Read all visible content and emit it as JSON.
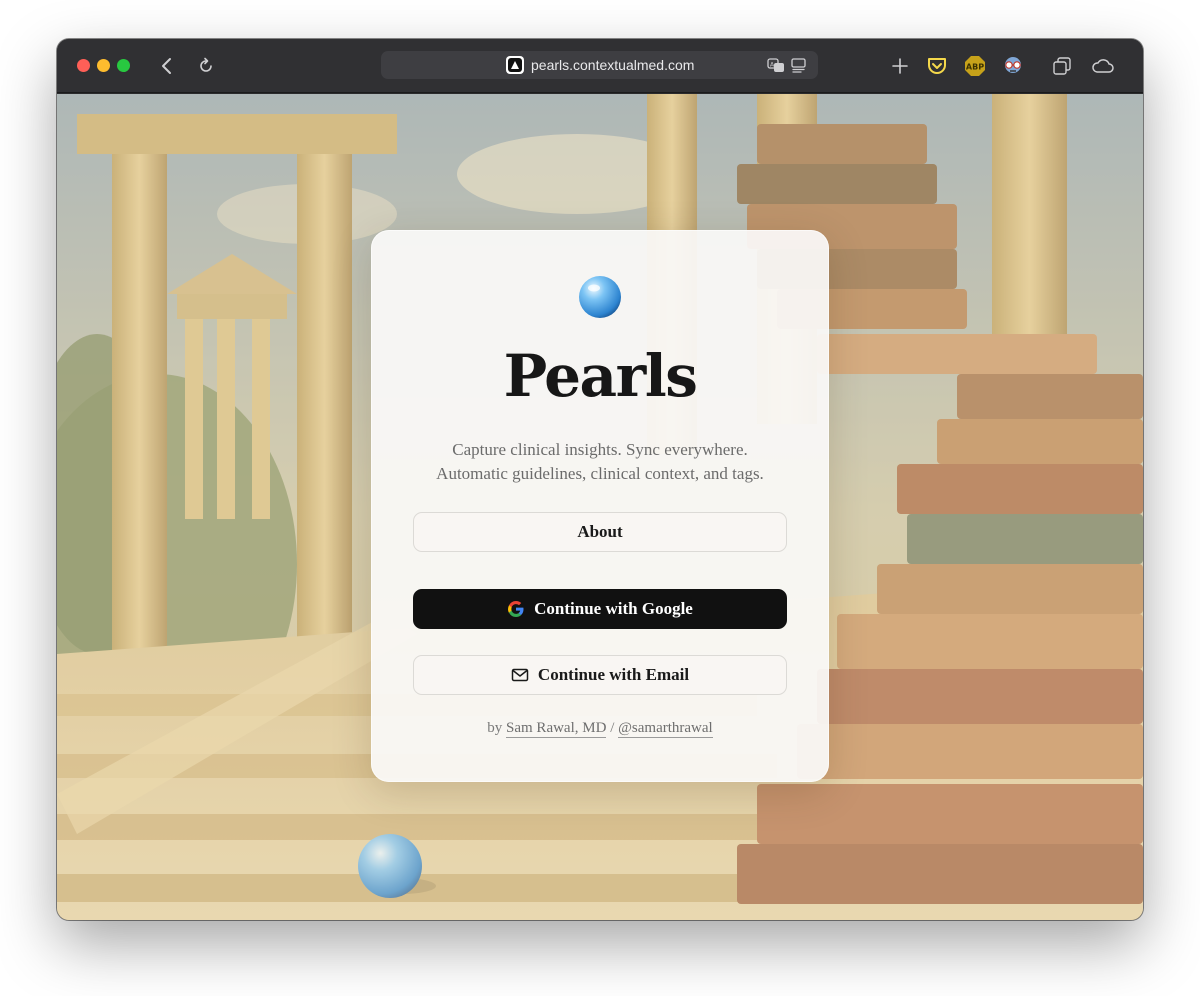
{
  "browser": {
    "url": "pearls.contextualmed.com",
    "icons": {
      "back": "chevron-left-icon",
      "reload": "reload-icon",
      "translate": "translate-icon",
      "reader": "reader-icon",
      "new_tab": "plus-icon",
      "pocket": "pocket-icon",
      "adblock": "ABP",
      "extension": "spy-glasses-icon",
      "tabs": "tab-overview-icon",
      "cloud": "cloud-icon"
    }
  },
  "card": {
    "title": "Pearls",
    "tagline_line1": "Capture clinical insights. Sync everywhere.",
    "tagline_line2": "Automatic guidelines, clinical context, and tags.",
    "about_label": "About",
    "google_label": "Continue with Google",
    "email_label": "Continue with Email",
    "byline_prefix": "by",
    "author_name": "Sam Rawal, MD",
    "separator": "/",
    "author_handle": "@samarthrawal"
  },
  "colors": {
    "accent_dark": "#111111",
    "pearl_blue": "#4aa3e8",
    "traffic_red": "#ff5f57",
    "traffic_yellow": "#febc2e",
    "traffic_green": "#28c840"
  }
}
